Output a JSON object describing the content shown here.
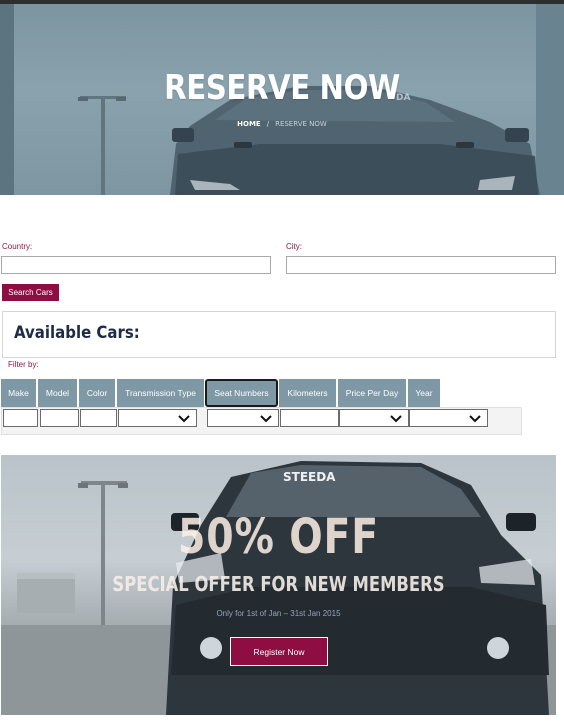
{
  "hero": {
    "title": "RESERVE NOW",
    "breadcrumb_home": "HOME",
    "breadcrumb_separator": "/",
    "breadcrumb_current": "RESERVE NOW",
    "windshield_text": "DA"
  },
  "search": {
    "country_label": "Country:",
    "country_value": "",
    "city_label": "City:",
    "city_value": "",
    "button_label": "Search Cars"
  },
  "results": {
    "heading": "Available Cars:",
    "filter_by_label": "Filter by:"
  },
  "filters": {
    "columns": [
      "Make",
      "Model",
      "Color",
      "Transmission Type",
      "Seat Numbers",
      "Kilometers",
      "Price Per Day",
      "Year"
    ],
    "active_column": "Seat Numbers"
  },
  "promo": {
    "windshield_text": "STEEDA",
    "headline": "50% OFF",
    "subheadline": "SPECIAL OFFER FOR NEW MEMBERS",
    "note": "Only for 1st of Jan – 31st Jan 2015",
    "button_label": "Register Now"
  },
  "colors": {
    "accent": "#8e0d43",
    "label": "#8b1b3f",
    "filter_header": "#7f98a6",
    "heading": "#1f2a44"
  }
}
